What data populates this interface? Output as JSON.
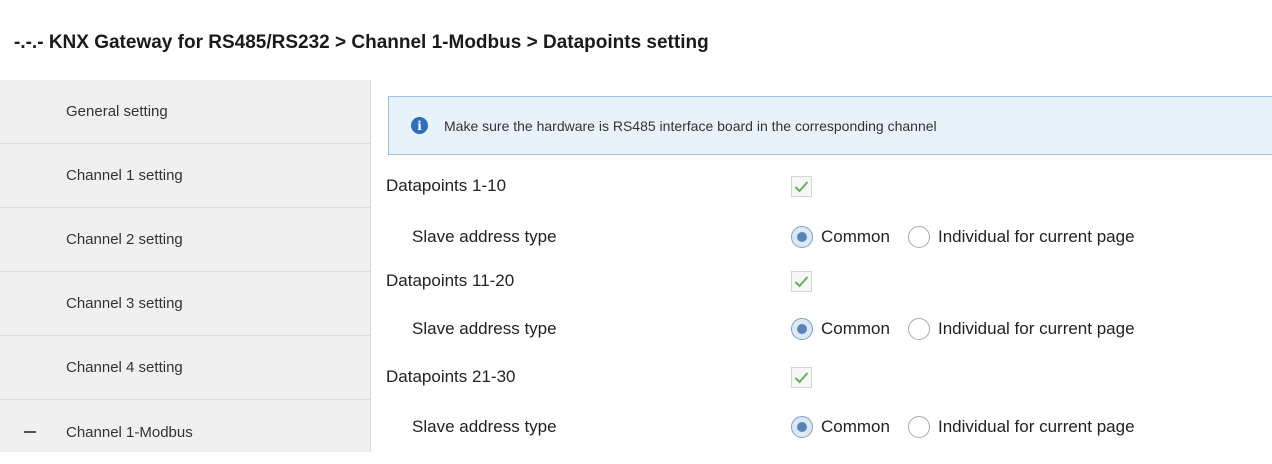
{
  "header": {
    "title": "-.-.- KNX Gateway for RS485/RS232 > Channel 1-Modbus > Datapoints setting"
  },
  "sidebar": {
    "items": [
      {
        "label": "General setting"
      },
      {
        "label": "Channel 1 setting"
      },
      {
        "label": "Channel 2 setting"
      },
      {
        "label": "Channel 3 setting"
      },
      {
        "label": "Channel 4 setting"
      },
      {
        "label": "Channel 1-Modbus",
        "expanded": true
      }
    ]
  },
  "main": {
    "info": {
      "icon": "info-icon",
      "text": "Make sure the hardware is RS485 interface board in the corresponding channel"
    },
    "groups": [
      {
        "label": "Datapoints 1-10",
        "checked": true,
        "sub_label": "Slave address type",
        "options": [
          "Common",
          "Individual for current page"
        ],
        "selected": "Common"
      },
      {
        "label": "Datapoints 11-20",
        "checked": true,
        "sub_label": "Slave address type",
        "options": [
          "Common",
          "Individual for current page"
        ],
        "selected": "Common"
      },
      {
        "label": "Datapoints 21-30",
        "checked": true,
        "sub_label": "Slave address type",
        "options": [
          "Common",
          "Individual for current page"
        ],
        "selected": "Common"
      }
    ]
  },
  "colors": {
    "info_background": "#e9f1fa",
    "info_border": "#9fc3e6",
    "info_icon": "#2d6fb8",
    "checkmark": "#6cae5e",
    "radio_selected": "#5a84b8",
    "sidebar_background": "#f0f0f0"
  }
}
